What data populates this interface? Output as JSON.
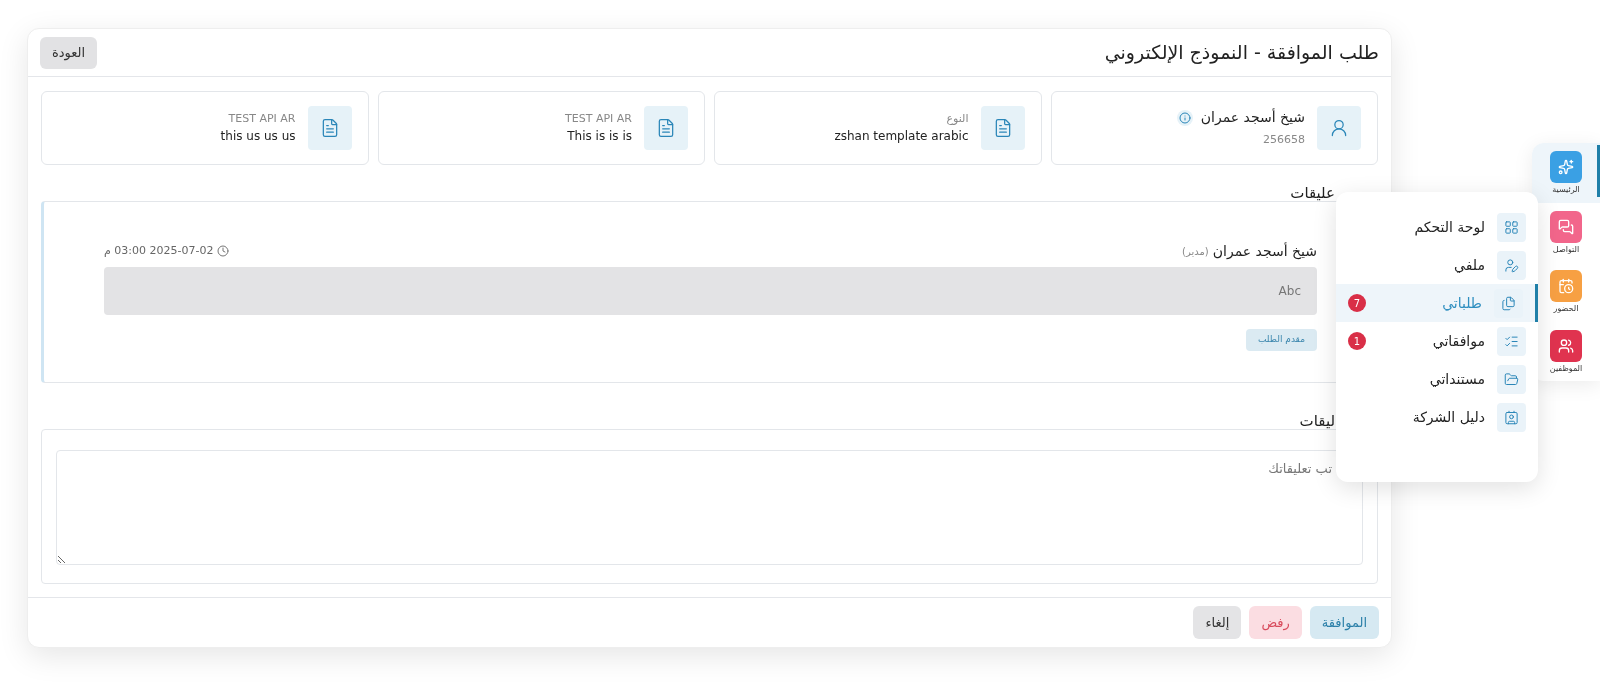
{
  "header": {
    "title": "طلب الموافقة - النموذج الإلكتروني",
    "back_button": "العودة"
  },
  "info_cards": [
    {
      "kind": "user",
      "title": "شيخ أسجد عمران",
      "subtitle": "256658"
    },
    {
      "kind": "document",
      "label": "النوع",
      "value": "zshan template arabic"
    },
    {
      "kind": "document",
      "label": "TEST API AR",
      "value": "This is is is"
    },
    {
      "kind": "document",
      "label": "TEST API AR",
      "value": "this us us us"
    }
  ],
  "comments_section": {
    "heading": "عليقات",
    "comments": [
      {
        "author": "شيخ أسجد عمران",
        "role": "(مدير)",
        "time": "2025-07-02 03:00 م",
        "text": "Abc",
        "tag": "مقدم الطلب"
      }
    ]
  },
  "add_comment": {
    "heading": "ليقات",
    "placeholder": "تب تعليقاتك"
  },
  "footer_buttons": [
    {
      "kind": "approve",
      "label": "الموافقة"
    },
    {
      "kind": "reject",
      "label": "رفض"
    },
    {
      "kind": "cancel",
      "label": "إلغاء"
    }
  ],
  "menu": {
    "items": [
      {
        "label": "لوحة التحكم",
        "selected": false
      },
      {
        "label": "ملفي",
        "selected": false
      },
      {
        "label": "طلباتي",
        "selected": true,
        "badge": "7"
      },
      {
        "label": "موافقاتي",
        "selected": false,
        "badge": "1"
      },
      {
        "label": "مستنداتي",
        "selected": false
      },
      {
        "label": "دليل الشركة",
        "selected": false
      }
    ]
  },
  "rail": {
    "items": [
      {
        "label": "الرئيسية",
        "selected": true,
        "color": "#3aa0e4"
      },
      {
        "label": "التواصل",
        "selected": false,
        "color": "#f2668b"
      },
      {
        "label": "الحضور",
        "selected": false,
        "color": "#f7a043"
      },
      {
        "label": "الموظفين",
        "selected": false,
        "color": "#e0334f"
      }
    ]
  }
}
